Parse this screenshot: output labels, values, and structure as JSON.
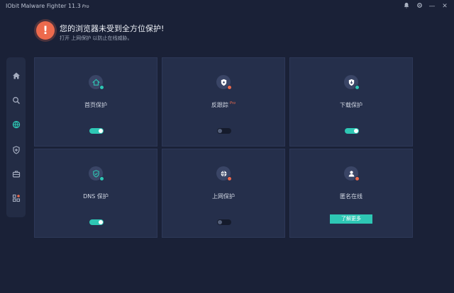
{
  "window": {
    "title": "IObit Malware Fighter 11.3",
    "pro_badge": "Pro",
    "controls": {
      "notifications_icon": "bell-icon",
      "settings_icon": "gear-icon",
      "minimize": "—",
      "close": "✕"
    }
  },
  "alert": {
    "icon_text": "!",
    "title": "您的浏览器未受到全方位保护!",
    "subtitle": "打开 上网保护 以防止在线威胁。"
  },
  "sidebar": {
    "items": [
      {
        "name": "home",
        "icon": "home-icon",
        "active": false
      },
      {
        "name": "scan",
        "icon": "search-icon",
        "active": false
      },
      {
        "name": "browser-protection",
        "icon": "globe-icon",
        "active": true
      },
      {
        "name": "protection",
        "icon": "shield-plus-icon",
        "active": false
      },
      {
        "name": "toolbox",
        "icon": "toolbox-icon",
        "active": false
      },
      {
        "name": "action-center",
        "icon": "grid-icon",
        "active": false
      }
    ]
  },
  "cards": [
    {
      "label": "首页保护",
      "icon": "home-shield-icon",
      "dot_color": "#2ec7b4",
      "state": "on",
      "pro": ""
    },
    {
      "label": "反跟踪",
      "icon": "shield-tracker-icon",
      "dot_color": "#ec6a4d",
      "state": "off",
      "pro": "Pro"
    },
    {
      "label": "下载保护",
      "icon": "download-shield-icon",
      "dot_color": "#2ec7b4",
      "state": "on",
      "pro": ""
    },
    {
      "label": "DNS 保护",
      "icon": "dns-shield-icon",
      "dot_color": "#2ec7b4",
      "state": "on",
      "pro": ""
    },
    {
      "label": "上网保护",
      "icon": "web-globe-icon",
      "dot_color": "#ec6a4d",
      "state": "off",
      "pro": ""
    },
    {
      "label": "匿名在线",
      "icon": "anonymous-user-icon",
      "dot_color": "#ec6a4d",
      "state": "button",
      "pro": "",
      "button_label": "了解更多"
    }
  ],
  "colors": {
    "accent": "#2ec7b4",
    "warning": "#ec6a4d",
    "background": "#1a2137",
    "card": "#252f4b"
  }
}
